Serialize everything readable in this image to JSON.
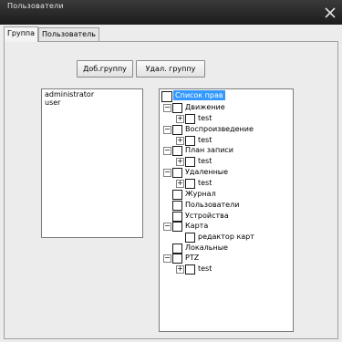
{
  "window": {
    "title": "Пользователи"
  },
  "tabs": [
    {
      "label": "Группа",
      "active": true
    },
    {
      "label": "Пользователь",
      "active": false
    }
  ],
  "buttons": {
    "add_group": "Доб.группу",
    "delete_group": "Удал. группу"
  },
  "groups": [
    "administrator",
    "user"
  ],
  "permissions": {
    "root": "Список прав",
    "items": [
      {
        "label": "Движение",
        "child": "test"
      },
      {
        "label": "Воспроизведение",
        "child": "test"
      },
      {
        "label": "План записи",
        "child": "test"
      },
      {
        "label": "Удаленные",
        "child": "test"
      },
      {
        "label": "Журнал"
      },
      {
        "label": "Пользователи"
      },
      {
        "label": "Устройства"
      },
      {
        "label": "Карта",
        "child": "редактор карт"
      },
      {
        "label": "Локальные"
      },
      {
        "label": "PTZ",
        "child": "test"
      }
    ]
  },
  "colors": {
    "titlebar": "#1c1c1c",
    "selection": "#3399ff",
    "body": "#ececec"
  }
}
